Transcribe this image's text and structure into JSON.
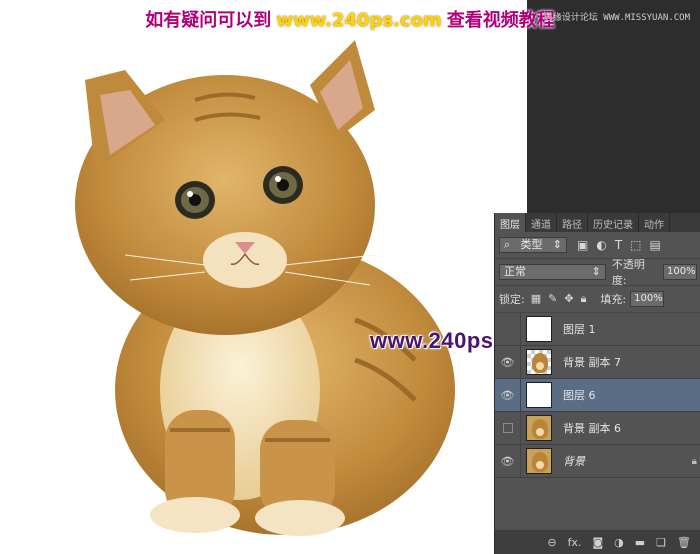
{
  "banner": {
    "part1": "如有疑问可以到",
    "site": "www.240ps.com",
    "part2": "查看视频教程"
  },
  "site_mark": "思缘设计论坛 WWW.MISSYUAN.COM",
  "watermark": "www.240ps.com",
  "panel": {
    "tabs": [
      "图层",
      "通道",
      "路径",
      "历史记录",
      "动作"
    ],
    "filter": {
      "icon": "search-icon",
      "kind_label": "类型",
      "icons": [
        "image-filter-icon",
        "adjustment-filter-icon",
        "type-filter-icon",
        "shape-filter-icon"
      ]
    },
    "blend_mode": "正常",
    "opacity_label": "不透明度:",
    "opacity_value": "100%",
    "lock_label": "锁定:",
    "fill_label": "填充:",
    "fill_value": "100%",
    "layers": [
      {
        "name": "图层 1",
        "visible": false,
        "thumb": "white",
        "selected": false
      },
      {
        "name": "背景 副本 7",
        "visible": true,
        "thumb": "checker-cat",
        "selected": false
      },
      {
        "name": "图层 6",
        "visible": true,
        "thumb": "white",
        "selected": true
      },
      {
        "name": "背景 副本 6",
        "visible": false,
        "thumb": "cat",
        "selected": false
      },
      {
        "name": "背景",
        "visible": true,
        "thumb": "cat",
        "selected": false,
        "locked": true
      }
    ],
    "footer_icons": [
      "link-icon",
      "fx-icon",
      "mask-icon",
      "adjustment-icon",
      "folder-icon",
      "new-layer-icon",
      "trash-icon"
    ],
    "fx_label": "fx."
  }
}
